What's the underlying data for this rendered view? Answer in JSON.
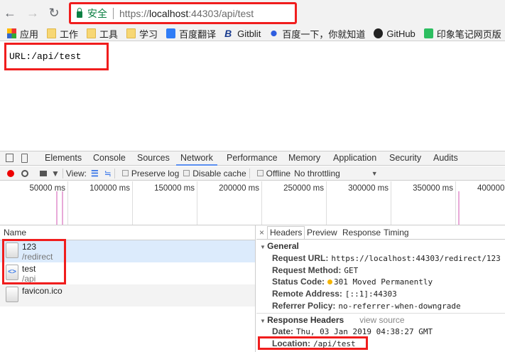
{
  "browser": {
    "back": "←",
    "forward": "→",
    "reload": "↻",
    "secure_label": "安全",
    "url_scheme": "https://",
    "url_host": "localhost",
    "url_rest": ":44303/api/test"
  },
  "bookmarks": [
    {
      "label": "应用",
      "icon": "apps-icon"
    },
    {
      "label": "工作",
      "icon": "folder-icon"
    },
    {
      "label": "工具",
      "icon": "folder-icon"
    },
    {
      "label": "学习",
      "icon": "folder-icon"
    },
    {
      "label": "百度翻译",
      "icon": "baidu-translate-icon"
    },
    {
      "label": "Gitblit",
      "icon": "gitblit-icon"
    },
    {
      "label": "百度一下，你就知道",
      "icon": "baidu-icon"
    },
    {
      "label": "GitHub",
      "icon": "github-icon"
    },
    {
      "label": "印象笔记网页版",
      "icon": "evernote-icon"
    }
  ],
  "page": {
    "text": "URL:/api/test"
  },
  "devtools": {
    "tabs": [
      "Elements",
      "Console",
      "Sources",
      "Network",
      "Performance",
      "Memory",
      "Application",
      "Security",
      "Audits"
    ],
    "active_tab": "Network",
    "toolbar": {
      "view": "View:",
      "preserve_log": "Preserve log",
      "disable_cache": "Disable cache",
      "offline": "Offline",
      "throttling": "No throttling"
    },
    "timeline_ticks": [
      "50000 ms",
      "100000 ms",
      "150000 ms",
      "200000 ms",
      "250000 ms",
      "300000 ms",
      "350000 ms",
      "400000 ms"
    ],
    "name_header": "Name",
    "requests": [
      {
        "name": "123",
        "path": "/redirect",
        "selected": true
      },
      {
        "name": "test",
        "path": "/api"
      },
      {
        "name": "favicon.ico",
        "path": ""
      }
    ],
    "detail_tabs": [
      "Headers",
      "Preview",
      "Response",
      "Timing"
    ],
    "general": {
      "title": "General",
      "rows": [
        {
          "k": "Request URL:",
          "v": "https://localhost:44303/redirect/123"
        },
        {
          "k": "Request Method:",
          "v": "GET"
        },
        {
          "k": "Status Code:",
          "v": "301 Moved Permanently"
        },
        {
          "k": "Remote Address:",
          "v": "[::1]:44303"
        },
        {
          "k": "Referrer Policy:",
          "v": "no-referrer-when-downgrade"
        }
      ]
    },
    "response_headers": {
      "title": "Response Headers",
      "view_source": "view source",
      "rows": [
        {
          "k": "Date:",
          "v": "Thu, 03 Jan 2019 04:38:27 GMT"
        },
        {
          "k": "Location:",
          "v": "/api/test"
        }
      ]
    },
    "colors": {
      "highlight": "#f01d1d",
      "status_dot": "#f5b400",
      "selected_row": "#dcebfc"
    }
  }
}
